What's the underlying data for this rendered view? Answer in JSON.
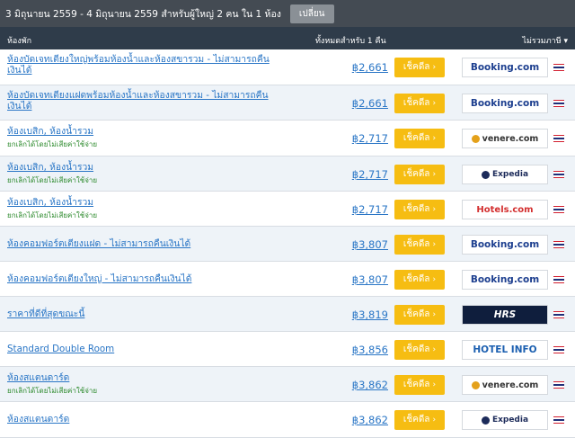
{
  "topbar": {
    "stay_text": "3 มิถุนายน 2559 - 4 มิถุนายน 2559 สำหรับผู้ใหญ่ 2 คน ใน 1 ห้อง",
    "change_label": "เปลี่ยน"
  },
  "header": {
    "room_col": "ห้องพัก",
    "total_col": "ทั้งหมดสำหรับ 1 คืน",
    "tax_col": "ไม่รวมภาษี ▾"
  },
  "deal_label": "เช็คดีล",
  "rows": [
    {
      "room": "ห้องบัดเจทเตียงใหญ่พร้อมห้องน้ำและห้องสขารวม - ไม่สามารถคืนเงินได้",
      "sub": "",
      "price": "฿2,661",
      "provider": "Booking.com",
      "logo": "booking"
    },
    {
      "room": "ห้องบัดเจทเตียงแฝดพร้อมห้องน้ำและห้องสขารวม - ไม่สามารถคืนเงินได้",
      "sub": "",
      "price": "฿2,661",
      "provider": "Booking.com",
      "logo": "booking"
    },
    {
      "room": "ห้องเบสิก, ห้องน้ำรวม",
      "sub": "ยกเลิกได้โดยไม่เสียค่าใช้จ่าย",
      "price": "฿2,717",
      "provider": "venere.com",
      "logo": "venere"
    },
    {
      "room": "ห้องเบสิก, ห้องน้ำรวม",
      "sub": "ยกเลิกได้โดยไม่เสียค่าใช้จ่าย",
      "price": "฿2,717",
      "provider": "Expedia",
      "logo": "expedia"
    },
    {
      "room": "ห้องเบสิก, ห้องน้ำรวม",
      "sub": "ยกเลิกได้โดยไม่เสียค่าใช้จ่าย",
      "price": "฿2,717",
      "provider": "Hotels.com",
      "logo": "hotels"
    },
    {
      "room": "ห้องคอมฟอร์ตเตียงแฝด - ไม่สามารถคืนเงินได้",
      "sub": "",
      "price": "฿3,807",
      "provider": "Booking.com",
      "logo": "booking"
    },
    {
      "room": "ห้องคอมฟอร์ตเตียงใหญ่ - ไม่สามารถคืนเงินได้",
      "sub": "",
      "price": "฿3,807",
      "provider": "Booking.com",
      "logo": "booking"
    },
    {
      "room": "ราคาที่ดีที่สุดขณะนี้",
      "sub": "",
      "price": "฿3,819",
      "provider": "HRS",
      "logo": "hrs"
    },
    {
      "room": "Standard Double Room",
      "sub": "",
      "price": "฿3,856",
      "provider": "HOTEL INFO",
      "logo": "hotelinfo"
    },
    {
      "room": "ห้องสแตนดาร์ด",
      "sub": "ยกเลิกได้โดยไม่เสียค่าใช้จ่าย",
      "price": "฿3,862",
      "provider": "venere.com",
      "logo": "venere"
    },
    {
      "room": "ห้องสแตนดาร์ด",
      "sub": "",
      "price": "฿3,862",
      "provider": "Expedia",
      "logo": "expedia"
    }
  ]
}
